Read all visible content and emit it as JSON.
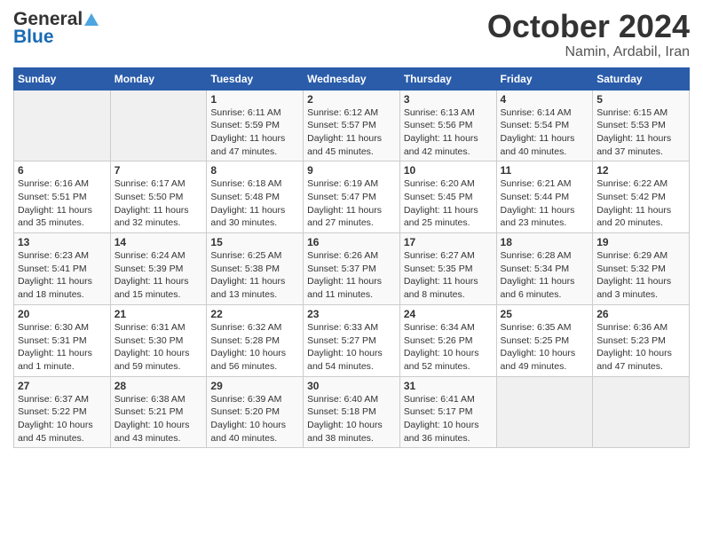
{
  "header": {
    "logo": {
      "general": "General",
      "blue": "Blue"
    },
    "title": "October 2024",
    "subtitle": "Namin, Ardabil, Iran"
  },
  "days_of_week": [
    "Sunday",
    "Monday",
    "Tuesday",
    "Wednesday",
    "Thursday",
    "Friday",
    "Saturday"
  ],
  "weeks": [
    [
      {
        "day": "",
        "sunrise": "",
        "sunset": "",
        "daylight": ""
      },
      {
        "day": "",
        "sunrise": "",
        "sunset": "",
        "daylight": ""
      },
      {
        "day": "1",
        "sunrise": "Sunrise: 6:11 AM",
        "sunset": "Sunset: 5:59 PM",
        "daylight": "Daylight: 11 hours and 47 minutes."
      },
      {
        "day": "2",
        "sunrise": "Sunrise: 6:12 AM",
        "sunset": "Sunset: 5:57 PM",
        "daylight": "Daylight: 11 hours and 45 minutes."
      },
      {
        "day": "3",
        "sunrise": "Sunrise: 6:13 AM",
        "sunset": "Sunset: 5:56 PM",
        "daylight": "Daylight: 11 hours and 42 minutes."
      },
      {
        "day": "4",
        "sunrise": "Sunrise: 6:14 AM",
        "sunset": "Sunset: 5:54 PM",
        "daylight": "Daylight: 11 hours and 40 minutes."
      },
      {
        "day": "5",
        "sunrise": "Sunrise: 6:15 AM",
        "sunset": "Sunset: 5:53 PM",
        "daylight": "Daylight: 11 hours and 37 minutes."
      }
    ],
    [
      {
        "day": "6",
        "sunrise": "Sunrise: 6:16 AM",
        "sunset": "Sunset: 5:51 PM",
        "daylight": "Daylight: 11 hours and 35 minutes."
      },
      {
        "day": "7",
        "sunrise": "Sunrise: 6:17 AM",
        "sunset": "Sunset: 5:50 PM",
        "daylight": "Daylight: 11 hours and 32 minutes."
      },
      {
        "day": "8",
        "sunrise": "Sunrise: 6:18 AM",
        "sunset": "Sunset: 5:48 PM",
        "daylight": "Daylight: 11 hours and 30 minutes."
      },
      {
        "day": "9",
        "sunrise": "Sunrise: 6:19 AM",
        "sunset": "Sunset: 5:47 PM",
        "daylight": "Daylight: 11 hours and 27 minutes."
      },
      {
        "day": "10",
        "sunrise": "Sunrise: 6:20 AM",
        "sunset": "Sunset: 5:45 PM",
        "daylight": "Daylight: 11 hours and 25 minutes."
      },
      {
        "day": "11",
        "sunrise": "Sunrise: 6:21 AM",
        "sunset": "Sunset: 5:44 PM",
        "daylight": "Daylight: 11 hours and 23 minutes."
      },
      {
        "day": "12",
        "sunrise": "Sunrise: 6:22 AM",
        "sunset": "Sunset: 5:42 PM",
        "daylight": "Daylight: 11 hours and 20 minutes."
      }
    ],
    [
      {
        "day": "13",
        "sunrise": "Sunrise: 6:23 AM",
        "sunset": "Sunset: 5:41 PM",
        "daylight": "Daylight: 11 hours and 18 minutes."
      },
      {
        "day": "14",
        "sunrise": "Sunrise: 6:24 AM",
        "sunset": "Sunset: 5:39 PM",
        "daylight": "Daylight: 11 hours and 15 minutes."
      },
      {
        "day": "15",
        "sunrise": "Sunrise: 6:25 AM",
        "sunset": "Sunset: 5:38 PM",
        "daylight": "Daylight: 11 hours and 13 minutes."
      },
      {
        "day": "16",
        "sunrise": "Sunrise: 6:26 AM",
        "sunset": "Sunset: 5:37 PM",
        "daylight": "Daylight: 11 hours and 11 minutes."
      },
      {
        "day": "17",
        "sunrise": "Sunrise: 6:27 AM",
        "sunset": "Sunset: 5:35 PM",
        "daylight": "Daylight: 11 hours and 8 minutes."
      },
      {
        "day": "18",
        "sunrise": "Sunrise: 6:28 AM",
        "sunset": "Sunset: 5:34 PM",
        "daylight": "Daylight: 11 hours and 6 minutes."
      },
      {
        "day": "19",
        "sunrise": "Sunrise: 6:29 AM",
        "sunset": "Sunset: 5:32 PM",
        "daylight": "Daylight: 11 hours and 3 minutes."
      }
    ],
    [
      {
        "day": "20",
        "sunrise": "Sunrise: 6:30 AM",
        "sunset": "Sunset: 5:31 PM",
        "daylight": "Daylight: 11 hours and 1 minute."
      },
      {
        "day": "21",
        "sunrise": "Sunrise: 6:31 AM",
        "sunset": "Sunset: 5:30 PM",
        "daylight": "Daylight: 10 hours and 59 minutes."
      },
      {
        "day": "22",
        "sunrise": "Sunrise: 6:32 AM",
        "sunset": "Sunset: 5:28 PM",
        "daylight": "Daylight: 10 hours and 56 minutes."
      },
      {
        "day": "23",
        "sunrise": "Sunrise: 6:33 AM",
        "sunset": "Sunset: 5:27 PM",
        "daylight": "Daylight: 10 hours and 54 minutes."
      },
      {
        "day": "24",
        "sunrise": "Sunrise: 6:34 AM",
        "sunset": "Sunset: 5:26 PM",
        "daylight": "Daylight: 10 hours and 52 minutes."
      },
      {
        "day": "25",
        "sunrise": "Sunrise: 6:35 AM",
        "sunset": "Sunset: 5:25 PM",
        "daylight": "Daylight: 10 hours and 49 minutes."
      },
      {
        "day": "26",
        "sunrise": "Sunrise: 6:36 AM",
        "sunset": "Sunset: 5:23 PM",
        "daylight": "Daylight: 10 hours and 47 minutes."
      }
    ],
    [
      {
        "day": "27",
        "sunrise": "Sunrise: 6:37 AM",
        "sunset": "Sunset: 5:22 PM",
        "daylight": "Daylight: 10 hours and 45 minutes."
      },
      {
        "day": "28",
        "sunrise": "Sunrise: 6:38 AM",
        "sunset": "Sunset: 5:21 PM",
        "daylight": "Daylight: 10 hours and 43 minutes."
      },
      {
        "day": "29",
        "sunrise": "Sunrise: 6:39 AM",
        "sunset": "Sunset: 5:20 PM",
        "daylight": "Daylight: 10 hours and 40 minutes."
      },
      {
        "day": "30",
        "sunrise": "Sunrise: 6:40 AM",
        "sunset": "Sunset: 5:18 PM",
        "daylight": "Daylight: 10 hours and 38 minutes."
      },
      {
        "day": "31",
        "sunrise": "Sunrise: 6:41 AM",
        "sunset": "Sunset: 5:17 PM",
        "daylight": "Daylight: 10 hours and 36 minutes."
      },
      {
        "day": "",
        "sunrise": "",
        "sunset": "",
        "daylight": ""
      },
      {
        "day": "",
        "sunrise": "",
        "sunset": "",
        "daylight": ""
      }
    ]
  ]
}
